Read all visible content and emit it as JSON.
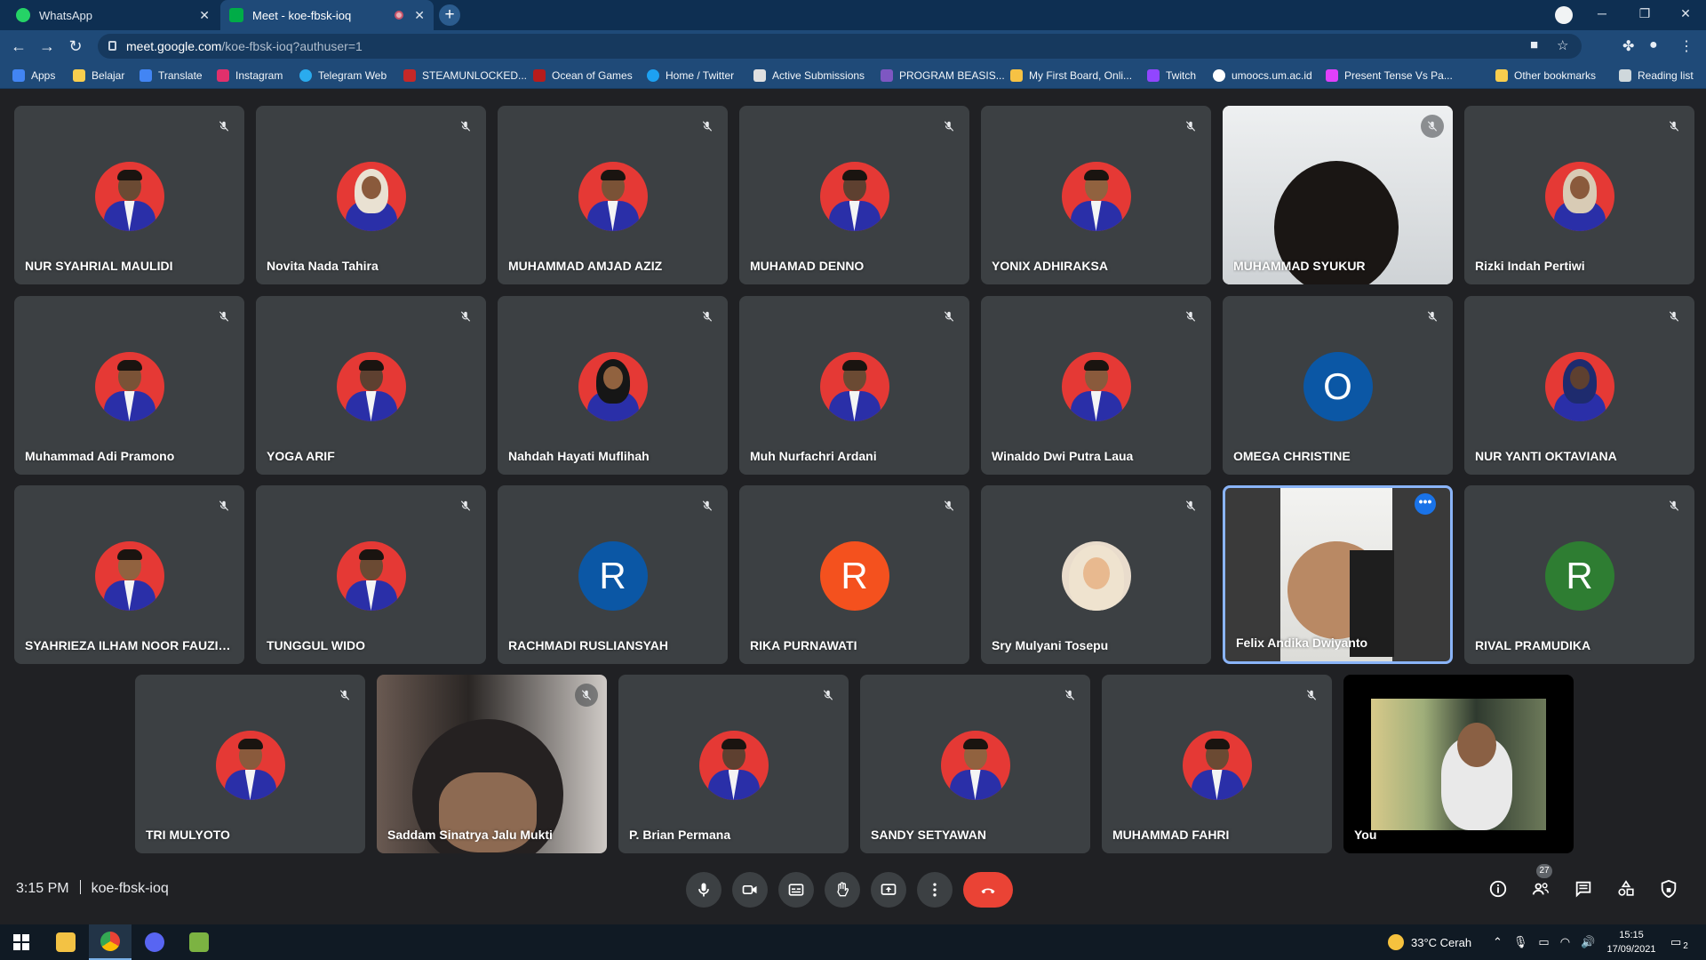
{
  "browser": {
    "tabs": [
      {
        "title": "WhatsApp",
        "favicon_color": "#25d366"
      },
      {
        "title": "Meet - koe-fbsk-ioq",
        "favicon_color": "#00ac47"
      }
    ],
    "url_host": "meet.google.com",
    "url_path": "/koe-fbsk-ioq?authuser=1",
    "bookmarks": [
      {
        "label": "Apps",
        "color": "#4285f4"
      },
      {
        "label": "Belajar",
        "color": "#f9ce4e"
      },
      {
        "label": "Translate",
        "color": "#4285f4"
      },
      {
        "label": "Instagram",
        "color": "#e1306c"
      },
      {
        "label": "Telegram Web",
        "color": "#2aabee"
      },
      {
        "label": "STEAMUNLOCKED...",
        "color": "#c62828"
      },
      {
        "label": "Ocean of Games",
        "color": "#b71c1c"
      },
      {
        "label": "Home / Twitter",
        "color": "#1da1f2"
      },
      {
        "label": "Active Submissions",
        "color": "#e0e0e0"
      },
      {
        "label": "PROGRAM BEASIS...",
        "color": "#7e57c2"
      },
      {
        "label": "My First Board, Onli...",
        "color": "#f6c244"
      },
      {
        "label": "Twitch",
        "color": "#9146ff"
      },
      {
        "label": "umoocs.um.ac.id",
        "color": "#ffffff"
      },
      {
        "label": "Present Tense Vs Pa...",
        "color": "#e040fb"
      },
      {
        "label": "Other bookmarks",
        "color": "#f9ce4e"
      },
      {
        "label": "Reading list",
        "color": "#cfd8dc"
      }
    ]
  },
  "participants": [
    {
      "name": "NUR SYAHRIAL MAULIDI",
      "type": "photo"
    },
    {
      "name": "Novita Nada Tahira",
      "type": "photo-hijab",
      "hijab": "#e9e1d2"
    },
    {
      "name": "MUHAMMAD AMJAD AZIZ",
      "type": "photo"
    },
    {
      "name": "MUHAMAD DENNO",
      "type": "photo"
    },
    {
      "name": "YONIX ADHIRAKSA",
      "type": "photo"
    },
    {
      "name": "MUHAMMAD SYUKUR",
      "type": "video"
    },
    {
      "name": "Rizki Indah Pertiwi",
      "type": "photo-hijab",
      "hijab": "#d8cbb5"
    },
    {
      "name": "Muhammad Adi Pramono",
      "type": "photo"
    },
    {
      "name": "YOGA ARIF",
      "type": "photo"
    },
    {
      "name": "Nahdah Hayati Muflihah",
      "type": "photo-hijab",
      "hijab": "#161616"
    },
    {
      "name": "Muh Nurfachri Ardani",
      "type": "photo"
    },
    {
      "name": "Winaldo Dwi Putra Laua",
      "type": "photo"
    },
    {
      "name": "OMEGA CHRISTINE",
      "type": "letter",
      "letter": "O",
      "color": "#0b57a5"
    },
    {
      "name": "NUR YANTI OKTAVIANA",
      "type": "photo-hijab",
      "hijab": "#1e2b6e"
    },
    {
      "name": "SYAHRIEZA ILHAM NOOR FAUZI 1...",
      "type": "photo"
    },
    {
      "name": "TUNGGUL WIDO",
      "type": "photo"
    },
    {
      "name": "RACHMADI RUSLIANSYAH",
      "type": "letter",
      "letter": "R",
      "color": "#0b57a5"
    },
    {
      "name": "RIKA PURNAWATI",
      "type": "letter",
      "letter": "R",
      "color": "#f4511e"
    },
    {
      "name": "Sry Mulyani Tosepu",
      "type": "photo-face"
    },
    {
      "name": "Felix Andika Dwiyanto",
      "type": "video"
    },
    {
      "name": "RIVAL PRAMUDIKA",
      "type": "letter",
      "letter": "R",
      "color": "#2e7d32"
    },
    {
      "name": "TRI MULYOTO",
      "type": "photo"
    },
    {
      "name": "Saddam Sinatrya Jalu Mukti",
      "type": "video"
    },
    {
      "name": "P. Brian Permana",
      "type": "photo"
    },
    {
      "name": "SANDY SETYAWAN",
      "type": "photo"
    },
    {
      "name": "MUHAMMAD FAHRI",
      "type": "photo"
    },
    {
      "name": "You",
      "type": "video"
    }
  ],
  "meeting": {
    "time": "3:15 PM",
    "code": "koe-fbsk-ioq",
    "people_count": "27"
  },
  "taskbar": {
    "weather": "33°C  Cerah",
    "time": "15:15",
    "date": "17/09/2021",
    "notifications": "2"
  }
}
